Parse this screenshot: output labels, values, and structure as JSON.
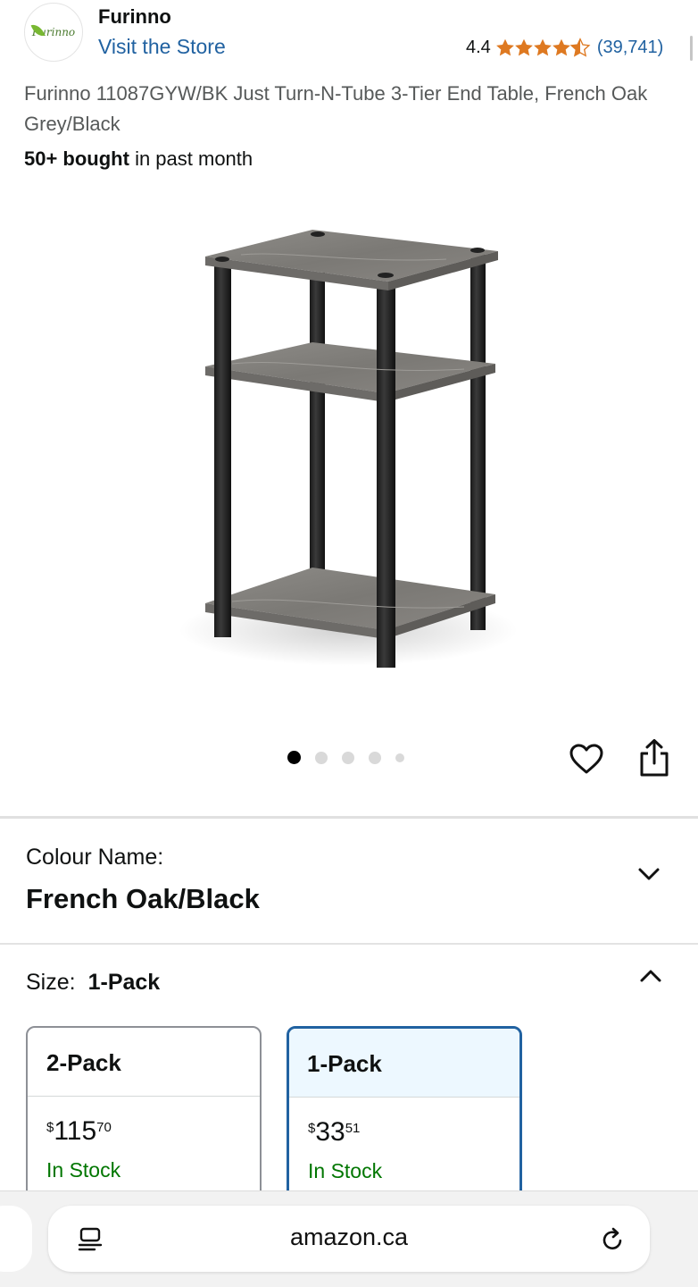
{
  "header": {
    "brand_name": "Furinno",
    "logo_text": "Furinno",
    "visit_store": "Visit the Store",
    "rating_value": "4.4",
    "rating_stars": 4.4,
    "rating_count": "(39,741)",
    "star_color": "#de7921"
  },
  "product": {
    "title": "Furinno 11087GYW/BK Just Turn-N-Tube 3-Tier End Table, French Oak Grey/Black",
    "bought_bold": "50+ bought",
    "bought_rest": " in past month",
    "image_count": 5,
    "active_image": 1
  },
  "icons": {
    "wishlist": "heart-icon",
    "share": "share-icon",
    "colour_toggle": "chevron-down-icon",
    "size_toggle": "chevron-up-icon",
    "reader": "reader-icon",
    "reload": "reload-icon"
  },
  "colour": {
    "label": "Colour Name:",
    "value": "French Oak/Black"
  },
  "size": {
    "label": "Size:",
    "value": "1-Pack",
    "options": [
      {
        "name": "2-Pack",
        "currency": "$",
        "whole": "115",
        "fraction": "70",
        "stock": "In Stock",
        "selected": false
      },
      {
        "name": "1-Pack",
        "currency": "$",
        "whole": "33",
        "fraction": "51",
        "stock": "In Stock",
        "selected": true
      }
    ]
  },
  "browser": {
    "url": "amazon.ca"
  },
  "colors": {
    "link": "#2162a1",
    "in_stock": "#007600",
    "selected_border": "#2162a1",
    "selected_bg": "#edf8ff"
  }
}
